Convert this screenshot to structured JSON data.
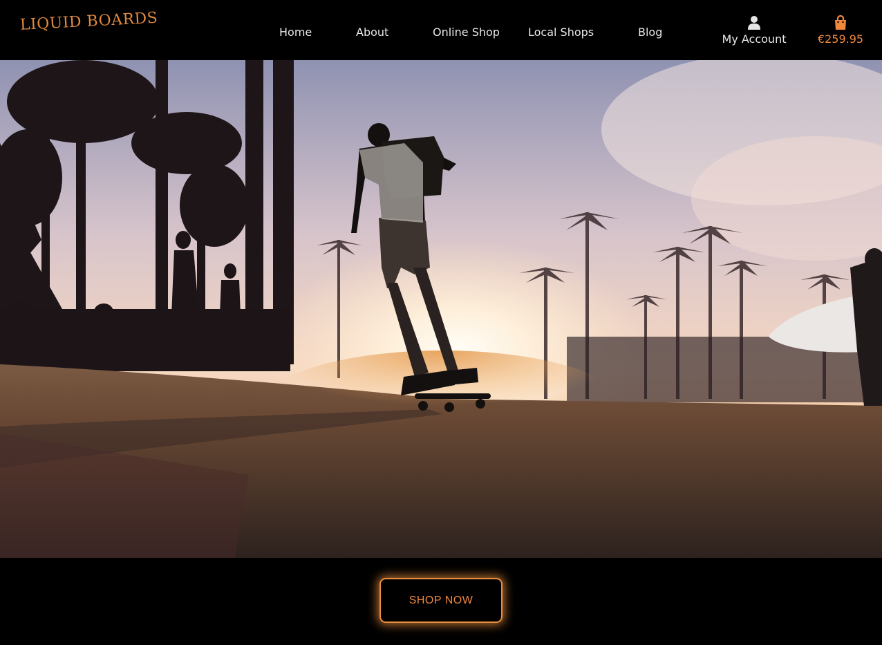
{
  "brand": {
    "logo_text": "LIQUID BOARDS"
  },
  "nav": {
    "items": [
      {
        "label": "Home"
      },
      {
        "label": "About"
      },
      {
        "label": "Online Shop"
      },
      {
        "label": "Local Shops"
      },
      {
        "label": "Blog"
      }
    ],
    "account_label": "My Account",
    "cart_total": "€259.95"
  },
  "icons": {
    "account": "user-icon",
    "cart": "shopping-bag-icon"
  },
  "hero": {
    "image": "sunset skateboarder under palm trees"
  },
  "cta": {
    "label": "SHOP NOW"
  },
  "colors": {
    "accent": "#f0883e",
    "background": "#000000",
    "nav_text": "#e9e9e9"
  }
}
